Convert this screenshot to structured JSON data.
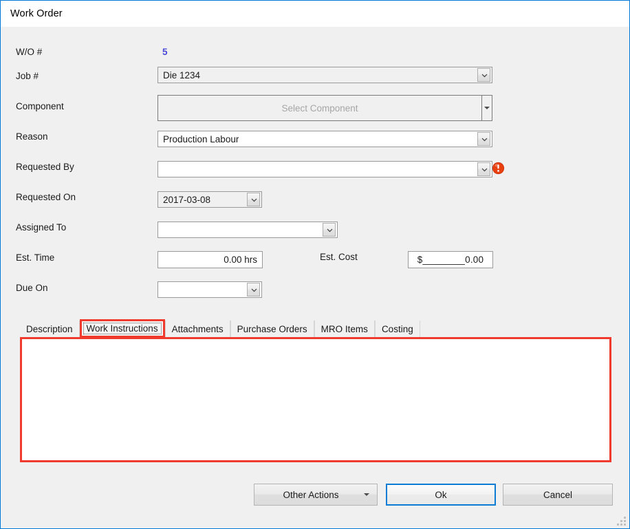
{
  "window": {
    "title": "Work Order",
    "accent_color": "#0078d7",
    "highlight_color": "#f03a2e"
  },
  "form": {
    "rows": [
      {
        "label": "W/O #",
        "value": "5"
      },
      {
        "label": "Job #",
        "value": "Die 1234"
      },
      {
        "label": "Component",
        "placeholder": "Select Component"
      },
      {
        "label": "Reason",
        "value": "Production Labour"
      },
      {
        "label": "Requested By",
        "value": ""
      },
      {
        "label": "Requested On",
        "value": "2017-03-08"
      },
      {
        "label": "Assigned To",
        "value": ""
      },
      {
        "label": "Est. Time",
        "value": "0.00 hrs"
      },
      {
        "label": "Due On",
        "value": ""
      }
    ],
    "est_cost": {
      "label": "Est. Cost",
      "value": "$________0.00"
    },
    "validation": {
      "icon": "error-exclamation-icon",
      "field": "Requested By",
      "color": "#e8400f"
    }
  },
  "tabs": {
    "items": [
      {
        "label": "Description",
        "selected": false
      },
      {
        "label": "Work Instructions",
        "selected": true
      },
      {
        "label": "Attachments",
        "selected": false
      },
      {
        "label": "Purchase Orders",
        "selected": false
      },
      {
        "label": "MRO Items",
        "selected": false
      },
      {
        "label": "Costing",
        "selected": false
      }
    ],
    "content": ""
  },
  "footer": {
    "other_actions": "Other Actions",
    "ok": "Ok",
    "cancel": "Cancel"
  }
}
